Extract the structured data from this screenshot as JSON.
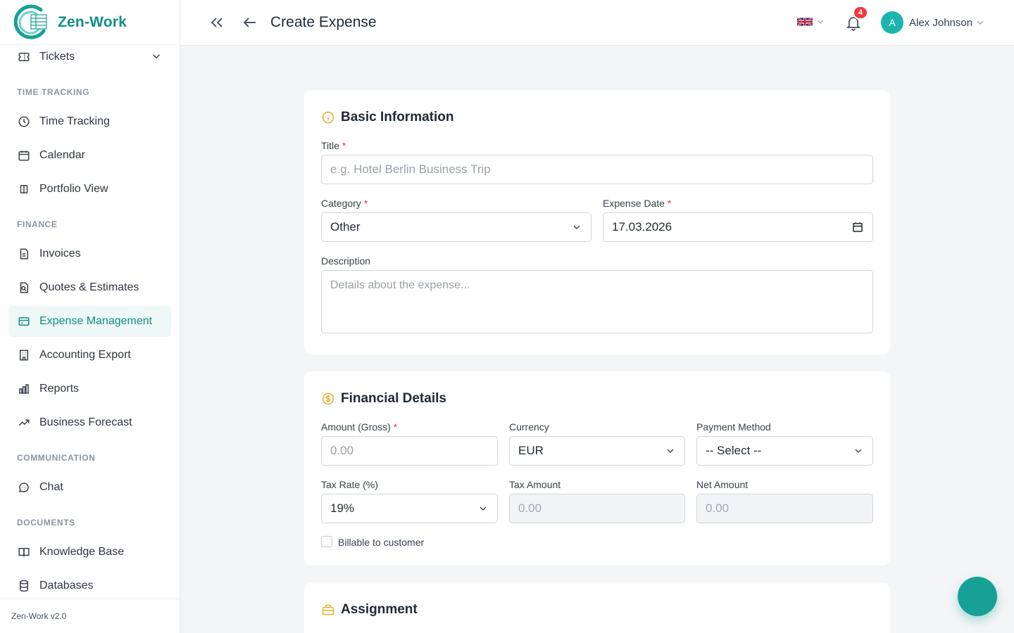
{
  "brand": {
    "name": "Zen-Work",
    "version": "Zen-Work v2.0"
  },
  "sidebar": {
    "top_item": {
      "label": "Tickets",
      "icon": "ticket-icon"
    },
    "sections": [
      {
        "label": "TIME TRACKING",
        "items": [
          {
            "label": "Time Tracking",
            "icon": "clock-icon"
          },
          {
            "label": "Calendar",
            "icon": "calendar-icon"
          },
          {
            "label": "Portfolio View",
            "icon": "columns-icon"
          }
        ]
      },
      {
        "label": "FINANCE",
        "items": [
          {
            "label": "Invoices",
            "icon": "file-icon"
          },
          {
            "label": "Quotes & Estimates",
            "icon": "file-search-icon"
          },
          {
            "label": "Expense Management",
            "icon": "credit-card-icon",
            "active": true
          },
          {
            "label": "Accounting Export",
            "icon": "building-icon"
          },
          {
            "label": "Reports",
            "icon": "bar-chart-icon"
          },
          {
            "label": "Business Forecast",
            "icon": "trending-up-icon"
          }
        ]
      },
      {
        "label": "COMMUNICATION",
        "items": [
          {
            "label": "Chat",
            "icon": "chat-icon"
          }
        ]
      },
      {
        "label": "DOCUMENTS",
        "items": [
          {
            "label": "Knowledge Base",
            "icon": "book-icon"
          },
          {
            "label": "Databases",
            "icon": "database-icon"
          }
        ]
      }
    ]
  },
  "header": {
    "title": "Create Expense",
    "language_icon": "uk-flag-icon",
    "notifications_count": "4",
    "user": {
      "initial": "A",
      "name": "Alex Johnson"
    }
  },
  "basic_info": {
    "title": "Basic Information",
    "title_label": "Title",
    "title_placeholder": "e.g. Hotel Berlin Business Trip",
    "category_label": "Category",
    "category_value": "Other",
    "date_label": "Expense Date",
    "date_value": "17.03.2026",
    "description_label": "Description",
    "description_placeholder": "Details about the expense..."
  },
  "financial": {
    "title": "Financial Details",
    "amount_label": "Amount (Gross)",
    "amount_placeholder": "0.00",
    "currency_label": "Currency",
    "currency_value": "EUR",
    "payment_label": "Payment Method",
    "payment_value": "-- Select --",
    "tax_rate_label": "Tax Rate (%)",
    "tax_rate_value": "19%",
    "tax_amount_label": "Tax Amount",
    "tax_amount_value": "0.00",
    "net_amount_label": "Net Amount",
    "net_amount_value": "0.00",
    "billable_label": "Billable to customer"
  },
  "assignment": {
    "title": "Assignment"
  },
  "colors": {
    "accent": "#0f8f85",
    "accent_bg": "#eef8f7",
    "badge": "#ef3b3b",
    "icon_yellow": "#e8b53a"
  }
}
